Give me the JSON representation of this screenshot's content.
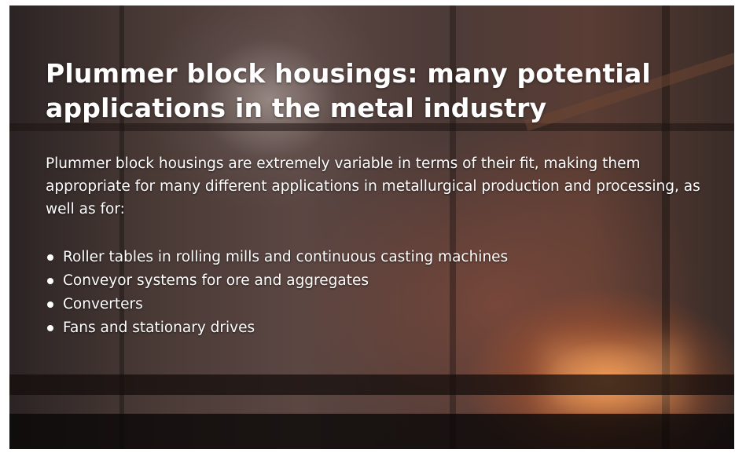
{
  "hero": {
    "title": "Plummer block housings: many potential applications in the metal industry",
    "intro": "Plummer block housings are extremely variable in terms of their fit, making them appropriate for many different applications in metallurgical production and processing, as well as for:",
    "bullets": [
      "Roller tables in rolling mills and continuous casting machines",
      "Conveyor systems for ore and aggregates",
      "Converters",
      "Fans and stationary drives"
    ],
    "background_image": "steel-mill-interior-photo"
  },
  "colors": {
    "text": "#ffffff",
    "glow": "#ff9646"
  }
}
